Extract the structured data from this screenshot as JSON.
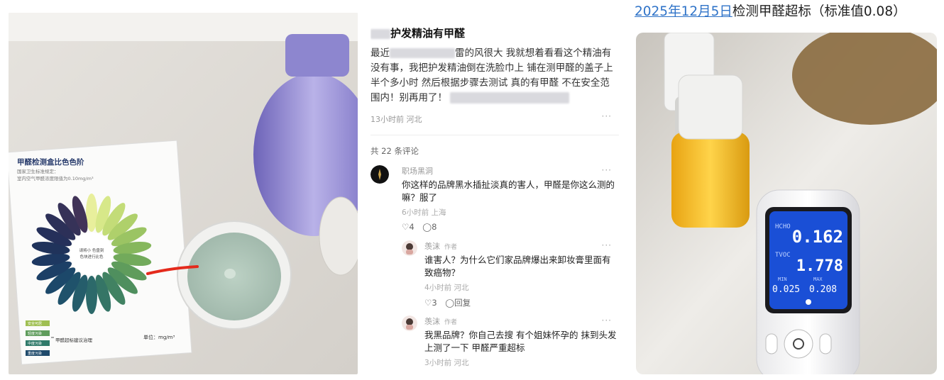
{
  "post": {
    "title_suffix": "护发精油有甲醛",
    "body_pre": "最近",
    "body_mid": "雷的风很大 我就想着看看这个精油",
    "body_rest": "有没有事，我把护发精油倒在洗脸巾上 铺在测甲醛的盖子上 半个多小时 然后根据步骤去测试 真的有甲醛 不在安全范围内！别再用了！",
    "meta": "13小时前 河北",
    "more": "···"
  },
  "comments_header": "共 22 条评论",
  "comments": [
    {
      "name": "职场黑洞",
      "text": "你这样的品牌黑水插扯淡真的害人，甲醛是你这么测的嘛？服了",
      "meta": "6小时前 上海",
      "likes": "4",
      "replies": "8",
      "more": "···"
    }
  ],
  "replies": [
    {
      "name": "羡沫",
      "tag": "作者",
      "text": "谁害人？为什么它们家品牌爆出来卸妆膏里面有致癌物？",
      "meta": "4小时前 河北",
      "likes": "3",
      "reply_label": "回复",
      "more": "···"
    },
    {
      "name": "羡沫",
      "tag": "作者",
      "text": "我黑品牌？你自己去搜 有个姐妹怀孕的 抹到头发上测了一下 甲醛严重超标",
      "meta": "3小时前 河北",
      "more": "···"
    }
  ],
  "chart_card": {
    "title": "甲醛检测盒比色色阶",
    "sub1": "国家卫生标准规定：",
    "sub2": "室内空气甲醛浓度限值为0.10mg/m³",
    "center1": "请将小 色盘刻",
    "center2": "色块进行比色",
    "unit": "单位：mg/m³",
    "legend_note": "甲醛超标建议治理",
    "legend": [
      "安全可居",
      "轻度污染",
      "中度污染",
      "重度污染"
    ]
  },
  "right": {
    "date": "2025年12月5日",
    "title_rest": "检测甲醛超标（标准值0.08）",
    "hcho": "0.162",
    "tvoc": "1.778",
    "min_value": "0.025",
    "max_value": "0.208",
    "hcho_label": "HCHO",
    "tvoc_label": "TVOC",
    "min_label": "MIN",
    "max_label": "MAX"
  },
  "colors": {
    "link": "#2f73c8",
    "screen": "#1a4fd6",
    "oil": "#f2b81b"
  }
}
